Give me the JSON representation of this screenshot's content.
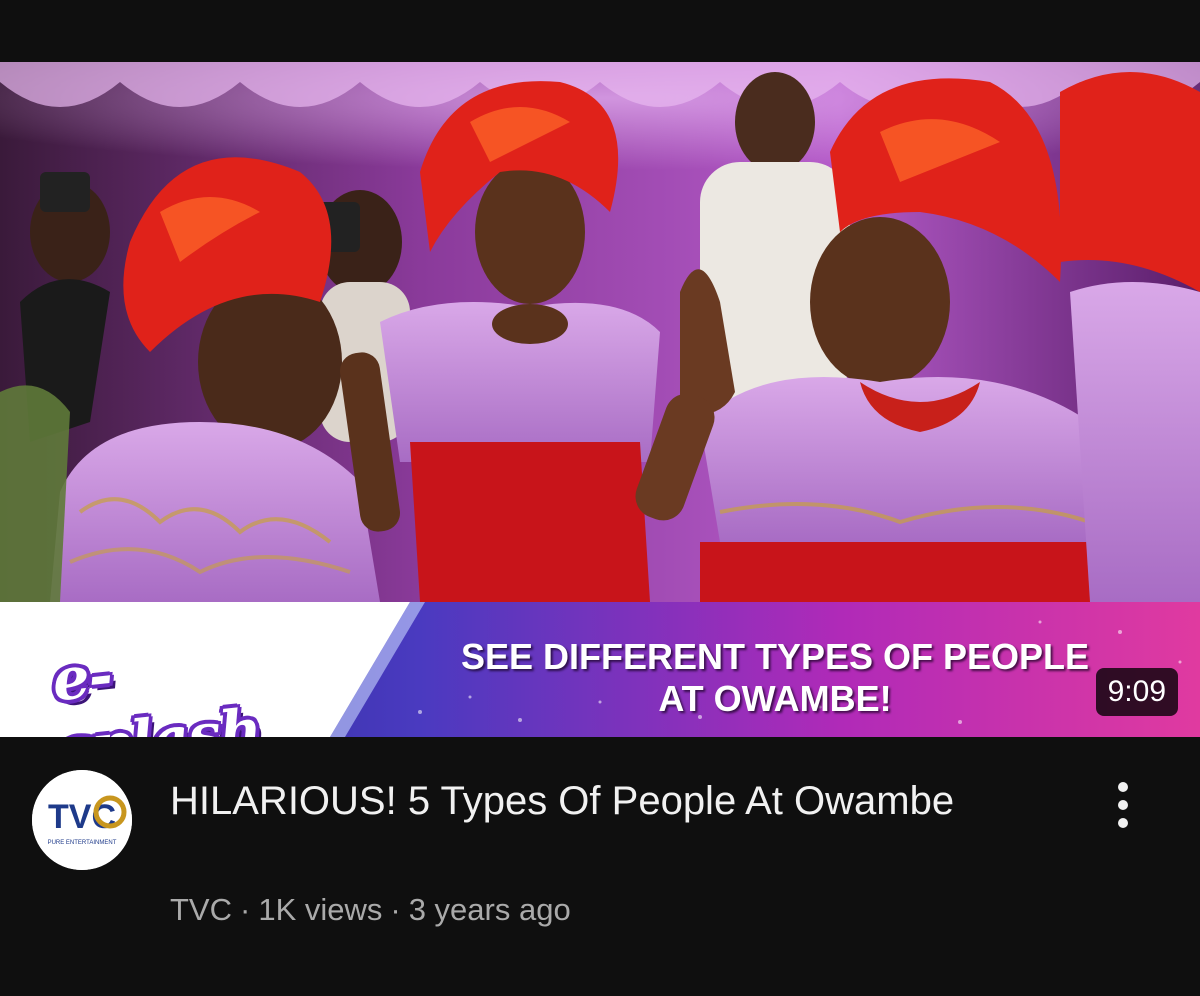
{
  "video": {
    "thumbnail": {
      "brand_logo_text": "e-splash",
      "headline_line1": "SEE DIFFERENT TYPES OF PEOPLE",
      "headline_line2": "AT OWAMBE!",
      "duration": "9:09"
    },
    "channel": {
      "avatar_text": "TVC",
      "avatar_tagline": "PURE ENTERTAINMENT",
      "name": "TVC"
    },
    "title": "HILARIOUS! 5 Types Of People At Owambe",
    "views": "1K views",
    "age": "3 years ago",
    "separator": "·",
    "more_icon": "more-vertical-icon"
  },
  "colors": {
    "background": "#0f0f0f",
    "title": "#f1f1f1",
    "secondary_text": "#aaaaaa",
    "brand_purple": "#6a2bc0",
    "banner_magenta": "#c02ab0",
    "banner_blue": "#2a3a9a"
  }
}
